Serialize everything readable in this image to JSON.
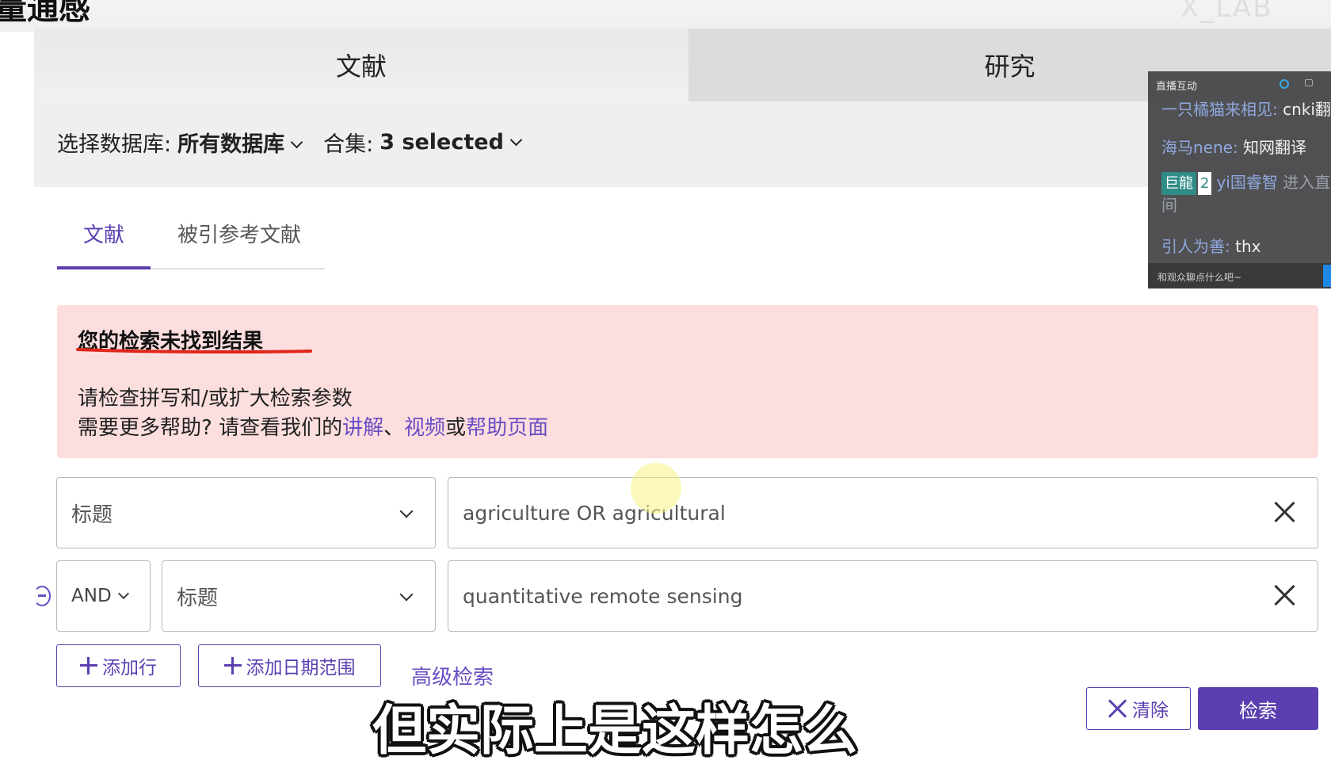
{
  "page": {
    "title_partial": "量通感",
    "watermark": "X_LAB"
  },
  "main_tabs": [
    {
      "label": "文献"
    },
    {
      "label": "研究"
    }
  ],
  "db_selector": {
    "database_label": "选择数据库:",
    "database_value": "所有数据库",
    "collection_label": "合集:",
    "collection_value": "3 selected"
  },
  "sub_tabs": [
    {
      "label": "文献",
      "active": true
    },
    {
      "label": "被引参考文献",
      "active": false
    }
  ],
  "alert": {
    "title": "您的检索未找到结果",
    "line1": "请检查拼写和/或扩大检索参数",
    "line2_prefix": "需要更多帮助? 请查看我们的",
    "link_tutorial": "讲解",
    "separator": "、",
    "link_video": "视频",
    "conj": "或",
    "link_help": "帮助页面",
    "underline_color": "#e0261b"
  },
  "search_rows": [
    {
      "field": "标题",
      "query": "agriculture OR agricultural"
    },
    {
      "operator": "AND",
      "field": "标题",
      "query": "quantitative remote sensing"
    }
  ],
  "actions": {
    "add_row": "添加行",
    "add_date_range": "添加日期范围",
    "advanced_search": "高级检索",
    "clear": "清除",
    "search": "检索"
  },
  "subtitle": "但实际上是这样怎么",
  "live_chat": {
    "header": "直播互动",
    "messages": [
      {
        "user": "一只橘猫来相见:",
        "text": " cnki翻"
      },
      {
        "user": "海马nene:",
        "text": " 知网翻译"
      },
      {
        "badge": "巨龍",
        "level": "2",
        "user": "yi国睿智",
        "text": " 进入直间"
      },
      {
        "user": "引人为善:",
        "text": " thx"
      }
    ],
    "input_placeholder": "和观众聊点什么吧~"
  },
  "colors": {
    "accent": "#5b3fb0",
    "link": "#6a4ec4",
    "alert_bg": "#fddede"
  }
}
